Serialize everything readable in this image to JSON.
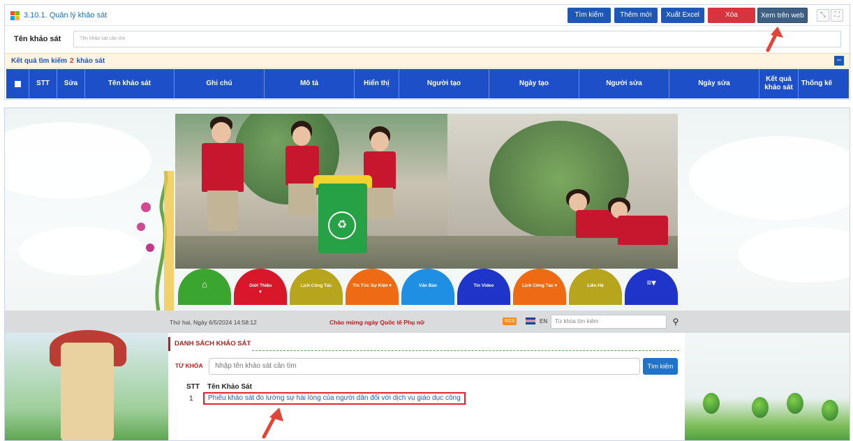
{
  "admin": {
    "title": "3.10.1. Quản lý khảo sát",
    "buttons": {
      "search": "Tìm kiếm",
      "add": "Thêm mới",
      "export": "Xuất Excel",
      "delete": "Xóa",
      "view_web": "Xem trên web"
    },
    "search": {
      "label": "Tên khảo sát",
      "placeholder": "Tên khảo sát cần tìm"
    },
    "result": {
      "prefix": "Kết quả tìm kiếm",
      "count": "2",
      "suffix": "khảo sát"
    },
    "table_headers": [
      "STT",
      "Sửa",
      "Tên khảo sát",
      "Ghi chú",
      "Mô tả",
      "Hiển thị",
      "Người tạo",
      "Ngày tạo",
      "Người sửa",
      "Ngày sửa",
      "Kết quả khảo sát",
      "Thống kê"
    ]
  },
  "web": {
    "menu": [
      "Giới Thiệu",
      "Lịch Công Tác",
      "Tin Tức Sự Kiện",
      "Văn Bản",
      "Tin Video",
      "Lịch Công Tác",
      "Liên Hệ"
    ],
    "menu_colors": [
      "#3aa52f",
      "#d8172a",
      "#b7a51d",
      "#ee6b13",
      "#1e8fe3",
      "#1f34c8",
      "#ee6b13",
      "#b7a51d",
      "#1f34c8"
    ],
    "date": "Thứ hai, Ngày 6/5/2024 14:58:12",
    "welcome": "Chào mừng ngày Quốc tế Phụ nữ",
    "rss": "RSS",
    "lang": "EN",
    "keyword_placeholder": "Từ khóa tìm kiếm",
    "section_title": "DANH SÁCH KHẢO SÁT",
    "keyword_label": "TỪ KHÓA",
    "survey_placeholder": "Nhập tên khảo sát cần tìm",
    "survey_search_btn": "Tìm kiếm",
    "col_stt": "STT",
    "col_name": "Tên Khảo Sát",
    "rows": [
      {
        "stt": "1",
        "name": "Phiếu khảo sát đo lường sự hài lòng của người dân đối với dịch vụ giáo dục công"
      }
    ]
  },
  "colors": {
    "accent_blue": "#1f57b8",
    "header_blue": "#1d4fc8",
    "danger": "#d9333f",
    "arrow": "#e0453a"
  }
}
